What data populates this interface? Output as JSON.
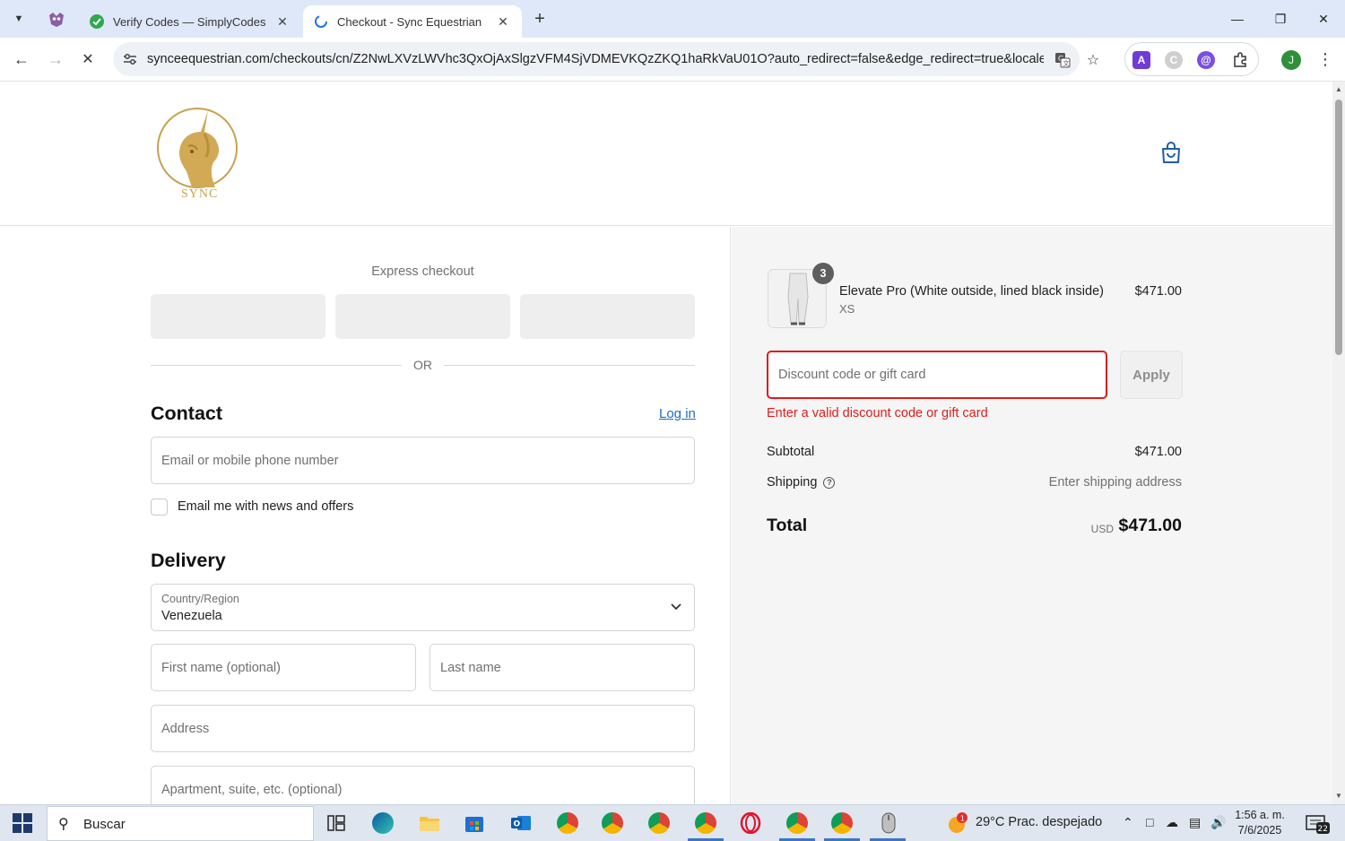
{
  "browser": {
    "tabs": [
      {
        "title": "Verify Codes — SimplyCodes",
        "active": false
      },
      {
        "title": "Checkout - Sync Equestrian",
        "active": true
      }
    ],
    "url": "synceequestrian.com/checkouts/cn/Z2NwLXVzLWVhc3QxOjAxSlgzVFM4SjVDMEVKQzZKQ1haRkVaU01O?auto_redirect=false&edge_redirect=true&locale=...",
    "profile_initial": "J"
  },
  "header": {
    "logo_text": "SYNC"
  },
  "express": {
    "title": "Express checkout",
    "or_text": "OR"
  },
  "contact": {
    "heading": "Contact",
    "login_link": "Log in",
    "email_placeholder": "Email or mobile phone number",
    "newsletter_label": "Email me with news and offers",
    "newsletter_checked": false
  },
  "delivery": {
    "heading": "Delivery",
    "country_label": "Country/Region",
    "country_value": "Venezuela",
    "first_name_placeholder": "First name (optional)",
    "last_name_placeholder": "Last name",
    "address_placeholder": "Address",
    "apartment_placeholder": "Apartment, suite, etc. (optional)"
  },
  "summary": {
    "item": {
      "name": "Elevate Pro (White outside, lined black inside)",
      "variant": "XS",
      "price": "$471.00",
      "quantity": "3"
    },
    "discount_placeholder": "Discount code or gift card",
    "apply_label": "Apply",
    "discount_error": "Enter a valid discount code or gift card",
    "subtotal_label": "Subtotal",
    "subtotal_value": "$471.00",
    "shipping_label": "Shipping",
    "shipping_value": "Enter shipping address",
    "total_label": "Total",
    "total_currency": "USD",
    "total_value": "$471.00"
  },
  "taskbar": {
    "search_text": "Buscar",
    "weather_badge": "1",
    "weather_text": "29°C  Prac. despejado",
    "time": "1:56 a. m.",
    "date": "7/6/2025",
    "notification_count": "22"
  },
  "colors": {
    "error": "#dd1d1d",
    "link": "#1f6fb8",
    "tabbar": "#dee8f9",
    "gold": "#c9a24e"
  }
}
